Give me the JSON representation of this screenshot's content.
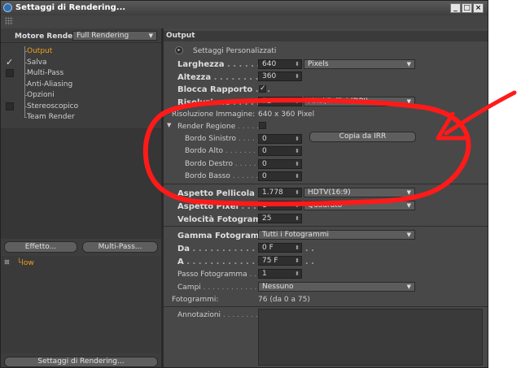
{
  "window": {
    "title": "Settaggi di Rendering..."
  },
  "left": {
    "renderer_label": "Motore Render",
    "renderer_value": "Full Rendering",
    "tree": [
      {
        "label": "Output",
        "active": true,
        "check": "none"
      },
      {
        "label": "Salva",
        "active": false,
        "check": "checked"
      },
      {
        "label": "Multi-Pass",
        "active": false,
        "check": "unchecked"
      },
      {
        "label": "Anti-Aliasing",
        "active": false,
        "check": "none"
      },
      {
        "label": "Opzioni",
        "active": false,
        "check": "none"
      },
      {
        "label": "Stereoscopico",
        "active": false,
        "check": "unchecked"
      },
      {
        "label": "Team Render",
        "active": false,
        "check": "none"
      }
    ],
    "effect_button": "Effetto...",
    "multipass_button": "Multi-Pass...",
    "preset_item": "low",
    "bottom_button": "Settaggi di Rendering..."
  },
  "right": {
    "section_title": "Output",
    "preset_label": "Settaggi Personalizzati",
    "width": {
      "label": "Larghezza",
      "value": "640",
      "unit": "Pixels"
    },
    "height": {
      "label": "Altezza",
      "value": "360"
    },
    "lock_ratio": {
      "label": "Blocca Rapporto",
      "check": "✓"
    },
    "resolution": {
      "label": "Risoluzione",
      "value": "72",
      "unit": "Pixel/Pollici (DPI)"
    },
    "image_res": {
      "label": "Risoluzione Immagine:",
      "value": "640 x 360 Pixel"
    },
    "region": {
      "label": "Render Regione"
    },
    "copy_irr": "Copia da IRR",
    "borders": [
      {
        "label": "Bordo Sinistro",
        "value": "0"
      },
      {
        "label": "Bordo Alto",
        "value": "0"
      },
      {
        "label": "Bordo Destro",
        "value": "0"
      },
      {
        "label": "Bordo Basso",
        "value": "0"
      }
    ],
    "film_aspect": {
      "label": "Aspetto Pellicola",
      "value": "1.778",
      "preset": "HDTV(16:9)"
    },
    "pixel_aspect": {
      "label": "Aspetto Pixel",
      "value": "1",
      "preset": "Quadrato"
    },
    "frame_rate": {
      "label": "Velocità Fotogramma",
      "value": "25"
    },
    "frame_range": {
      "label": "Gamma Fotogramma",
      "value": "Tutti i Fotogrammi"
    },
    "from": {
      "label": "Da",
      "value": "0 F"
    },
    "to": {
      "label": "A",
      "value": "75 F"
    },
    "frame_step": {
      "label": "Passo Fotogramma",
      "value": "1"
    },
    "fields": {
      "label": "Campi",
      "value": "Nessuno"
    },
    "frames": {
      "label": "Fotogrammi:",
      "value": "76 (da 0 a 75)"
    },
    "notes": {
      "label": "Annotazioni"
    }
  },
  "annotation": {
    "stroke": "#ff1a1a"
  },
  "colors": {
    "active": "#f0a020",
    "panel": "#484848",
    "field": "#2e2e2e"
  }
}
